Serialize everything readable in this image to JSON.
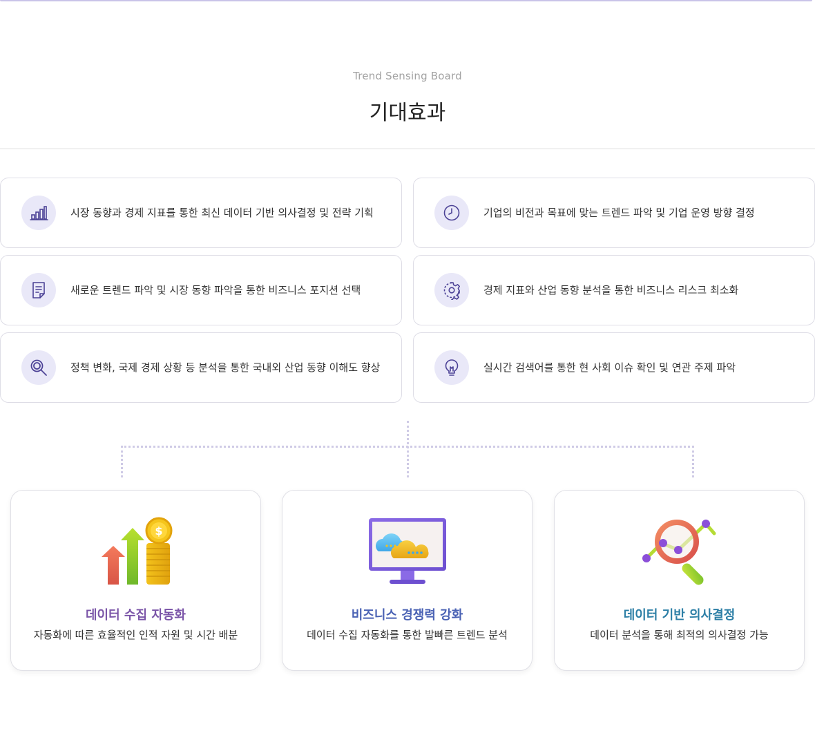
{
  "header": {
    "subtitle": "Trend Sensing Board",
    "title": "기대효과"
  },
  "effects": [
    {
      "icon": "bar-chart-icon",
      "text": "시장 동향과 경제 지표를 통한 최신 데이터 기반 의사결정 및 전략 기획"
    },
    {
      "icon": "clock-icon",
      "text": "기업의 비전과 목표에 맞는 트렌드 파악 및 기업 운영 방향 결정"
    },
    {
      "icon": "document-icon",
      "text": "새로운 트렌드 파악 및 시장 동향 파악을 통한 비즈니스 포지션 선택"
    },
    {
      "icon": "gear-icon",
      "text": "경제 지표와 산업 동향 분석을 통한 비즈니스 리스크 최소화"
    },
    {
      "icon": "search-icon",
      "text": "정책 변화, 국제 경제 상황 등 분석을 통한 국내외 산업 동향 이해도 향상"
    },
    {
      "icon": "lightbulb-icon",
      "text": "실시간 검색어를 통한 현 사회 이슈 확인 및 연관 주제 파악"
    }
  ],
  "benefits": [
    {
      "title": "데이터 수집 자동화",
      "desc": "자동화에 따른 효율적인 인적 자원 및 시간 배분",
      "color": "#7b55a8",
      "icon": "growth-coins-icon"
    },
    {
      "title": "비즈니스 경쟁력 강화",
      "desc": "데이터 수집 자동화를 통한 발빠른 트렌드 분석",
      "color": "#4a62b4",
      "icon": "cloud-monitor-icon"
    },
    {
      "title": "데이터 기반 의사결정",
      "desc": "데이터 분석을 통해 최적의 의사결정 가능",
      "color": "#2d7fa6",
      "icon": "magnifier-analysis-icon"
    }
  ],
  "colors": {
    "accent": "#5a4fa3",
    "icon_bg": "#e9e8f8"
  }
}
